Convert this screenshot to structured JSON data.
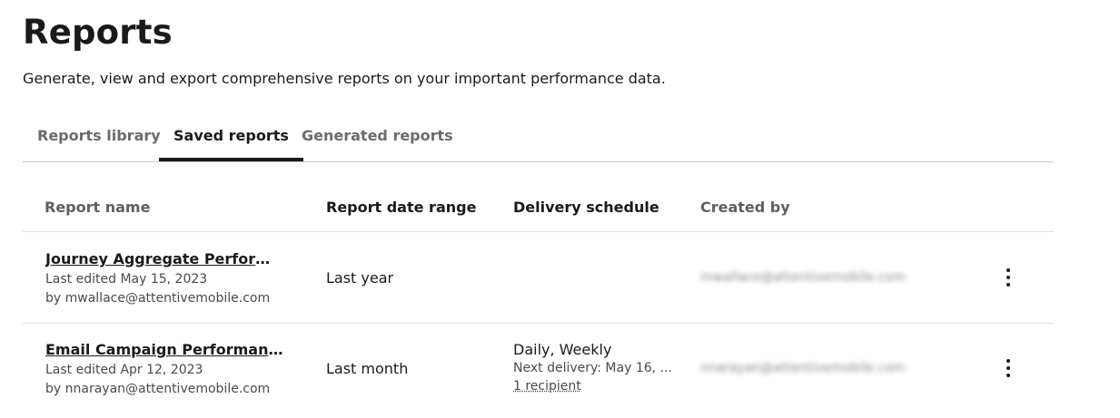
{
  "page": {
    "title": "Reports",
    "subtitle": "Generate, view and export comprehensive reports on your important performance data."
  },
  "tabs": [
    {
      "label": "Reports library",
      "active": false
    },
    {
      "label": "Saved reports",
      "active": true
    },
    {
      "label": "Generated reports",
      "active": false
    }
  ],
  "table": {
    "headers": {
      "name": "Report name",
      "date_range": "Report date range",
      "schedule": "Delivery schedule",
      "created_by": "Created by"
    },
    "rows": [
      {
        "name": "Journey Aggregate Performance...",
        "last_edited": "Last edited May 15, 2023",
        "by": "by mwallace@attentivemobile.com",
        "date_range": "Last year",
        "schedule_main": "",
        "schedule_next": "",
        "schedule_recipients": "",
        "created_by": "mwallace@attentivemobile.com",
        "actions_icon": "kebab-menu-icon"
      },
      {
        "name": "Email Campaign Performance",
        "last_edited": "Last edited Apr 12, 2023",
        "by": "by nnarayan@attentivemobile.com",
        "date_range": "Last month",
        "schedule_main": "Daily, Weekly",
        "schedule_next": "Next delivery: May 16, ...",
        "schedule_recipients": "1 recipient",
        "created_by": "nnarayan@attentivemobile.com",
        "actions_icon": "kebab-menu-icon"
      }
    ]
  }
}
